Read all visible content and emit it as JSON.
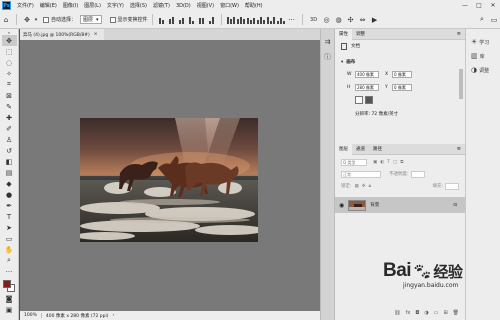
{
  "menubar": {
    "logo": "Ps",
    "items": [
      "文件(F)",
      "编辑(E)",
      "图像(I)",
      "图层(L)",
      "文字(Y)",
      "选择(S)",
      "滤镜(T)",
      "3D(D)",
      "视图(V)",
      "窗口(W)",
      "帮助(H)"
    ],
    "window_controls": [
      "—",
      "□",
      "✕"
    ]
  },
  "options_bar": {
    "auto_select_label": "自动选择：",
    "auto_select_value": "图层",
    "show_transform_label": "显示变换控件",
    "more_label": "···"
  },
  "document": {
    "tab_label": "奔马 (4).jpg @ 100%(RGB/8#)",
    "tab_close": "×"
  },
  "statusbar": {
    "zoom": "100%",
    "doc_info": "400 像素 x 280 像素 (72 ppi)",
    "arrow": "›"
  },
  "properties": {
    "tabs": [
      "属性",
      "调整"
    ],
    "doc_label": "文档",
    "section": "画布",
    "w_label": "W",
    "w_value": "400 像素",
    "h_label": "H",
    "h_value": "280 像素",
    "x_label": "X",
    "x_value": "0 像素",
    "y_label": "Y",
    "y_value": "0 像素",
    "resolution": "分辨率: 72 像素/英寸"
  },
  "layers": {
    "tabs": [
      "图层",
      "通道",
      "路径"
    ],
    "kind_label": "Q 类型",
    "blend_mode": "正常",
    "opacity_label": "不透明度:",
    "lock_label": "锁定:",
    "fill_label": "填充:",
    "layer_name": "背景"
  },
  "right_panel": {
    "items": [
      "学习",
      "库",
      "调整"
    ]
  },
  "watermark": {
    "brand": "Bai",
    "brand2": "经验",
    "url": "jingyan.baidu.com"
  },
  "colors": {
    "foreground": "#8a1a17",
    "background": "#ffffff"
  }
}
